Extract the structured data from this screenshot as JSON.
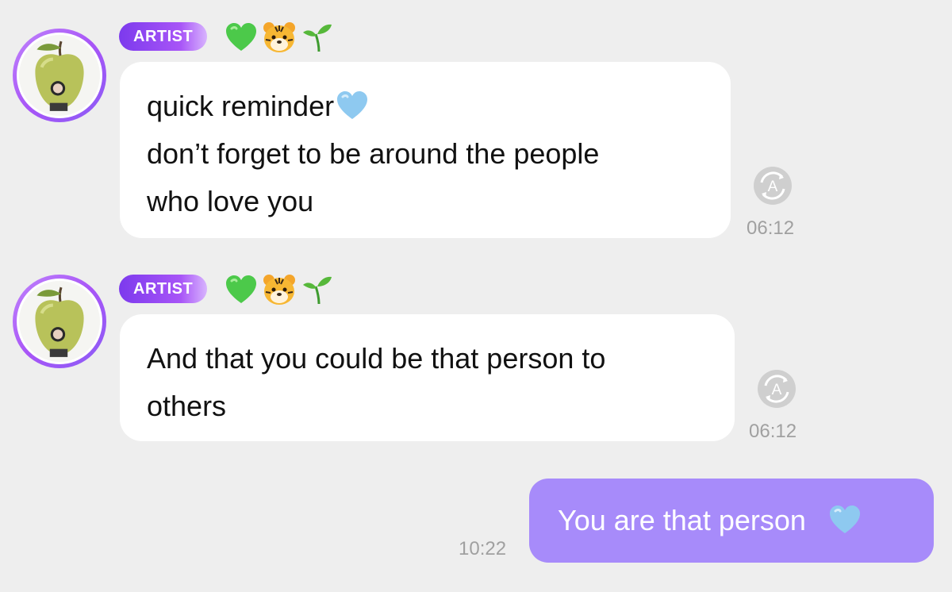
{
  "messages": [
    {
      "sender_badge": "ARTIST",
      "badge_emojis": [
        "green-heart",
        "tiger-face",
        "seedling"
      ],
      "lines": [
        "quick reminder",
        "don’t forget to be around the people",
        "who love you"
      ],
      "inline_emoji": "light-blue-heart",
      "translate_icon": "A",
      "time": "06:12"
    },
    {
      "sender_badge": "ARTIST",
      "badge_emojis": [
        "green-heart",
        "tiger-face",
        "seedling"
      ],
      "lines": [
        "And that you could be that person to",
        "others"
      ],
      "translate_icon": "A",
      "time": "06:12"
    }
  ],
  "reply": {
    "text": "You are that person",
    "emoji": "light-blue-heart",
    "time": "10:22"
  },
  "colors": {
    "background": "#eeeeee",
    "badge": "#8b5cf6",
    "my_bubble": "#a78bfa",
    "time": "#a0a0a0"
  }
}
